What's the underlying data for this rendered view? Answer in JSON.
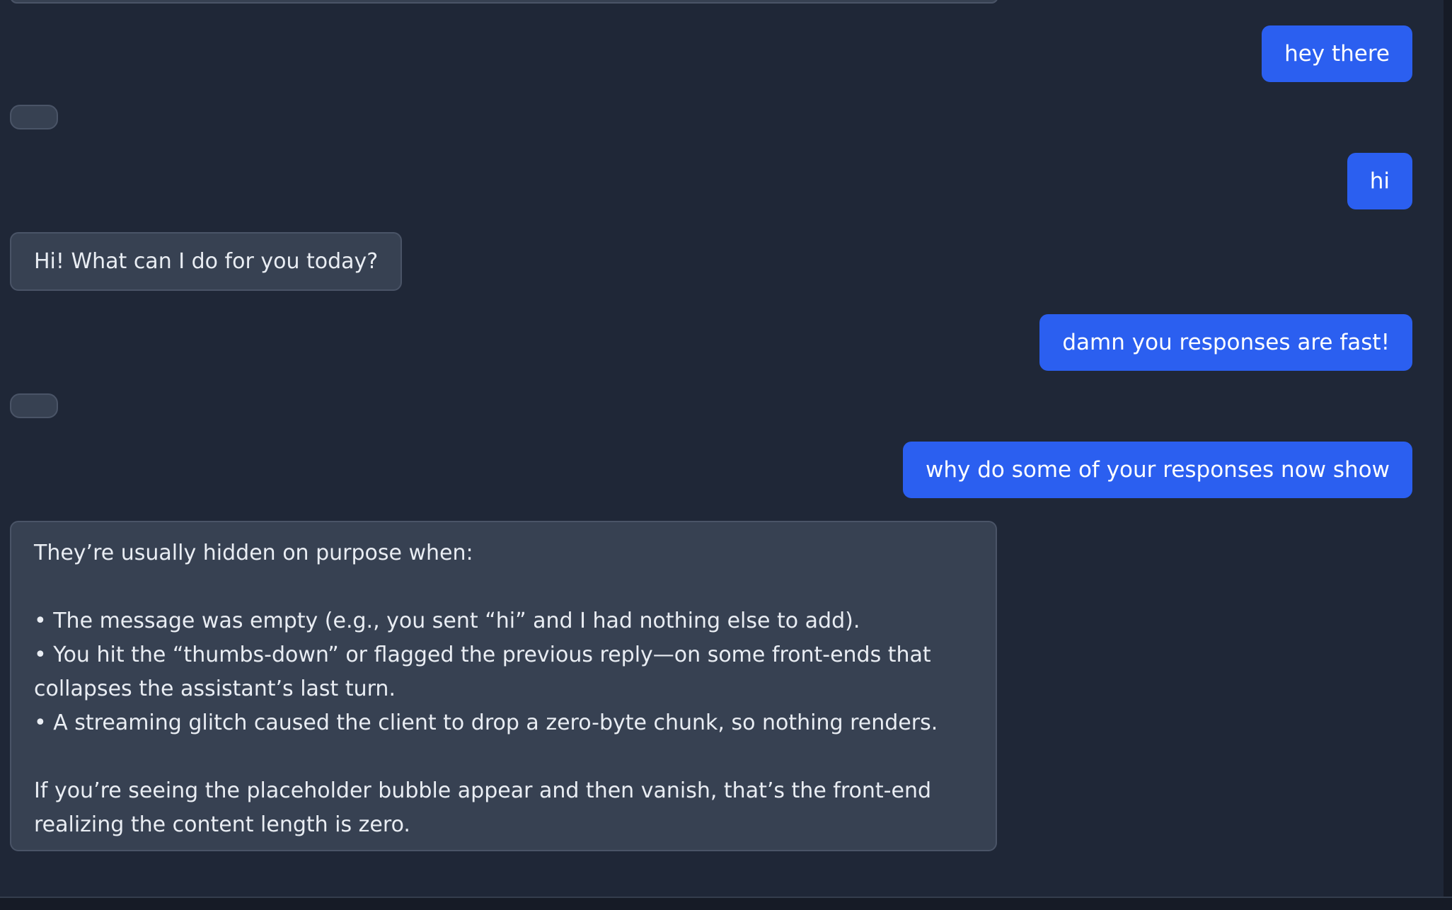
{
  "messages": [
    {
      "role": "user",
      "text": "hey there"
    },
    {
      "role": "assistant",
      "text": ""
    },
    {
      "role": "user",
      "text": "hi"
    },
    {
      "role": "assistant",
      "text": "Hi! What can I do for you today?"
    },
    {
      "role": "user",
      "text": "damn you responses are fast!"
    },
    {
      "role": "assistant",
      "text": ""
    },
    {
      "role": "user",
      "text": "why do some of your responses now show"
    },
    {
      "role": "assistant",
      "lines": [
        "They’re usually hidden on purpose when:",
        "",
        "• The message was empty (e.g., you sent “hi” and I had nothing else to add).",
        "• You hit the “thumbs-down” or flagged the previous reply—on some front-ends that collapses the assistant’s last turn.",
        "• A streaming glitch caused the client to drop a zero-byte chunk, so nothing renders.",
        "",
        "If you’re seeing the placeholder bubble appear and then vanish, that’s the front-end realizing the content length is zero."
      ]
    }
  ],
  "colors": {
    "background": "#1f2737",
    "user_bubble": "#2b5ff0",
    "assistant_bubble": "#374152",
    "assistant_border": "#4a5467"
  }
}
